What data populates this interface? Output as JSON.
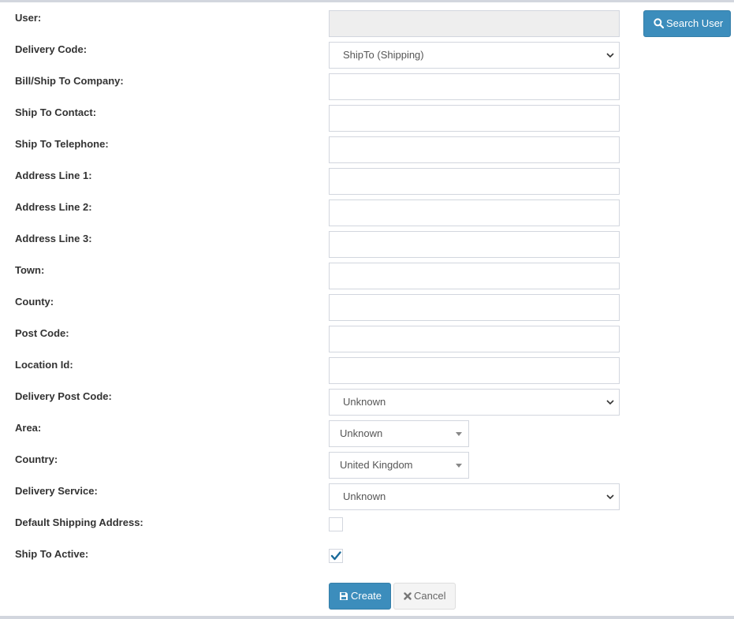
{
  "colors": {
    "primary": "#3c8dbc",
    "border": "#d2d6de",
    "readonly_bg": "#eeeeee",
    "check": "#1a6b9a"
  },
  "form": {
    "user": {
      "label": "User:",
      "value": ""
    },
    "delivery_code": {
      "label": "Delivery Code:",
      "value": "ShipTo (Shipping)"
    },
    "bill_ship_company": {
      "label": "Bill/Ship To Company:",
      "value": ""
    },
    "ship_to_contact": {
      "label": "Ship To Contact:",
      "value": ""
    },
    "ship_to_telephone": {
      "label": "Ship To Telephone:",
      "value": ""
    },
    "address_line_1": {
      "label": "Address Line 1:",
      "value": ""
    },
    "address_line_2": {
      "label": "Address Line 2:",
      "value": ""
    },
    "address_line_3": {
      "label": "Address Line 3:",
      "value": ""
    },
    "town": {
      "label": "Town:",
      "value": ""
    },
    "county": {
      "label": "County:",
      "value": ""
    },
    "post_code": {
      "label": "Post Code:",
      "value": ""
    },
    "location_id": {
      "label": "Location Id:",
      "value": ""
    },
    "delivery_post_code": {
      "label": "Delivery Post Code:",
      "value": "Unknown"
    },
    "area": {
      "label": "Area:",
      "value": "Unknown"
    },
    "country": {
      "label": "Country:",
      "value": "United Kingdom"
    },
    "delivery_service": {
      "label": "Delivery Service:",
      "value": "Unknown"
    },
    "default_shipping": {
      "label": "Default Shipping Address:",
      "checked": false
    },
    "ship_to_active": {
      "label": "Ship To Active:",
      "checked": true
    }
  },
  "buttons": {
    "search_user": "Search User",
    "create": "Create",
    "cancel": "Cancel"
  },
  "icons": {
    "search": "search-icon",
    "save": "floppy-disk-icon",
    "cancel": "close-icon",
    "dropdown": "chevron-down-icon",
    "checkmark": "checkmark-icon"
  }
}
